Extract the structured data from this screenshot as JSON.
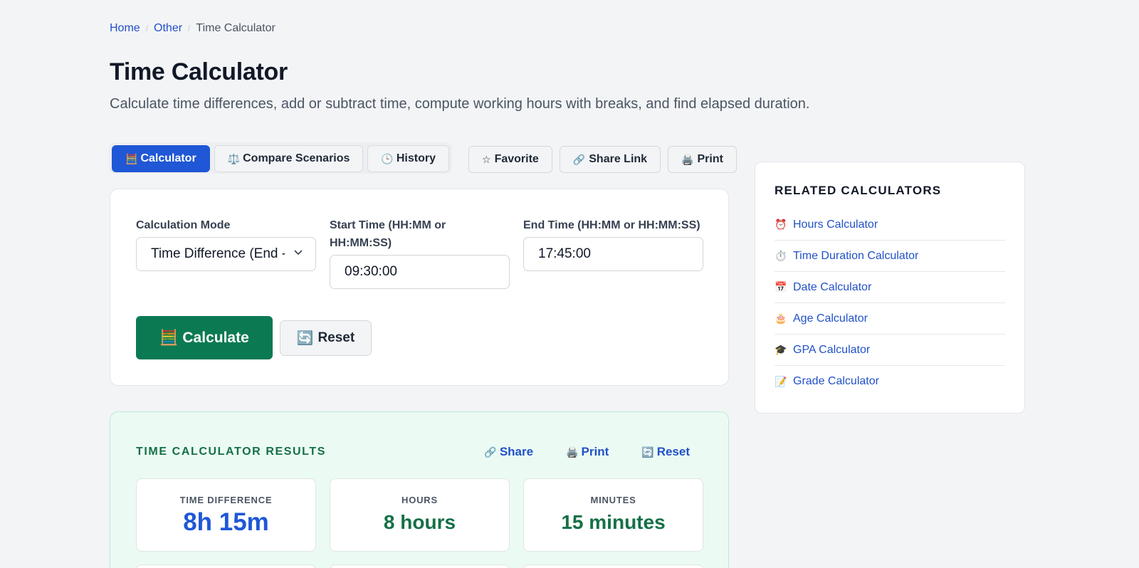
{
  "breadcrumb": {
    "home": "Home",
    "other": "Other",
    "current": "Time Calculator",
    "sep": "/"
  },
  "title": "Time Calculator",
  "description": "Calculate time differences, add or subtract time, compute working hours with breaks, and find elapsed duration.",
  "tabs": [
    {
      "icon": "🧮",
      "label": "Calculator"
    },
    {
      "icon": "⚖️",
      "label": "Compare Scenarios"
    },
    {
      "icon": "🕒",
      "label": "History"
    }
  ],
  "actions": [
    {
      "icon": "☆",
      "label": "Favorite"
    },
    {
      "icon": "🔗",
      "label": "Share Link"
    },
    {
      "icon": "🖨️",
      "label": "Print"
    }
  ],
  "form": {
    "mode_label": "Calculation Mode",
    "mode_value": "Time Difference (End - Start)",
    "start_label": "Start Time (HH:MM or HH:MM:SS)",
    "start_value": "09:30:00",
    "end_label": "End Time (HH:MM or HH:MM:SS)",
    "end_value": "17:45:00",
    "calculate_icon": "🧮",
    "calculate_label": "Calculate",
    "reset_icon": "🔄",
    "reset_label": "Reset"
  },
  "results": {
    "title": "TIME CALCULATOR RESULTS",
    "share_icon": "🔗",
    "share_label": "Share",
    "print_icon": "🖨️",
    "print_label": "Print",
    "reset_icon": "🔄",
    "reset_label": "Reset",
    "stats": [
      {
        "label": "TIME DIFFERENCE",
        "value": "8h 15m"
      },
      {
        "label": "HOURS",
        "value": "8 hours"
      },
      {
        "label": "MINUTES",
        "value": "15 minutes"
      }
    ]
  },
  "sidebar": {
    "title": "RELATED CALCULATORS",
    "items": [
      {
        "icon": "⏰",
        "label": "Hours Calculator"
      },
      {
        "icon": "⏱️",
        "label": "Time Duration Calculator"
      },
      {
        "icon": "📅",
        "label": "Date Calculator"
      },
      {
        "icon": "🎂",
        "label": "Age Calculator"
      },
      {
        "icon": "🎓",
        "label": "GPA Calculator"
      },
      {
        "icon": "📝",
        "label": "Grade Calculator"
      }
    ]
  },
  "colors": {
    "primary": "#1f57d6",
    "success": "#0b7a52",
    "link": "#2151c7",
    "results_bg": "#ebfbf3"
  }
}
